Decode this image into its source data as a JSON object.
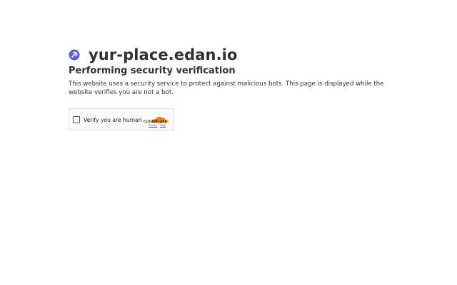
{
  "header": {
    "site_name": "yur-place.edan.io",
    "icon": "site-favicon-icon"
  },
  "verification": {
    "title": "Performing security verification",
    "description": "This website uses a security service to protect against malicious bots. This page is displayed while the website verifies you are not a bot."
  },
  "widget": {
    "checkbox_label": "Verify you are human",
    "brand": "CLOUDFLARE",
    "privacy_link": "Privacy",
    "separator": "•",
    "help_link": "Help"
  },
  "colors": {
    "accent_icon": "#5b5bd6",
    "cloudflare_orange": "#f38020",
    "text": "#313131"
  }
}
